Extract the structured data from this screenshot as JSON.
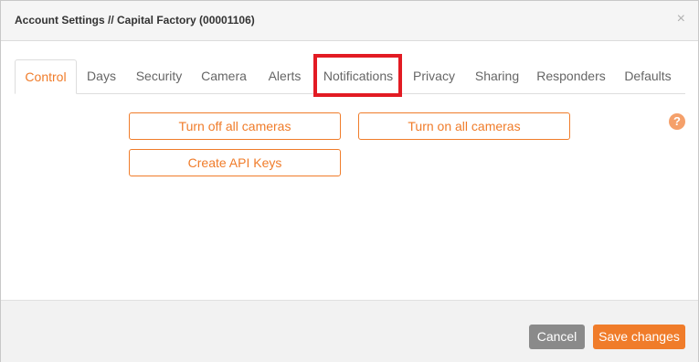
{
  "dialog": {
    "title": "Account Settings // Capital Factory (00001106)",
    "close_label": "×"
  },
  "tabs": [
    {
      "label": "Control",
      "active": true
    },
    {
      "label": "Days",
      "active": false
    },
    {
      "label": "Security",
      "active": false
    },
    {
      "label": "Camera",
      "active": false
    },
    {
      "label": "Alerts",
      "active": false
    },
    {
      "label": "Notifications",
      "active": false,
      "highlighted": true
    },
    {
      "label": "Privacy",
      "active": false
    },
    {
      "label": "Sharing",
      "active": false
    },
    {
      "label": "Responders",
      "active": false
    },
    {
      "label": "Defaults",
      "active": false
    }
  ],
  "control": {
    "turn_off_label": "Turn off all cameras",
    "turn_on_label": "Turn on all cameras",
    "create_api_label": "Create API Keys",
    "help_glyph": "?"
  },
  "footer": {
    "cancel_label": "Cancel",
    "save_label": "Save changes"
  },
  "colors": {
    "accent": "#f07c2a",
    "highlight": "#e21b23",
    "cancel": "#8a8a8a"
  },
  "icons": {
    "close": "close-icon",
    "help": "help-icon"
  }
}
